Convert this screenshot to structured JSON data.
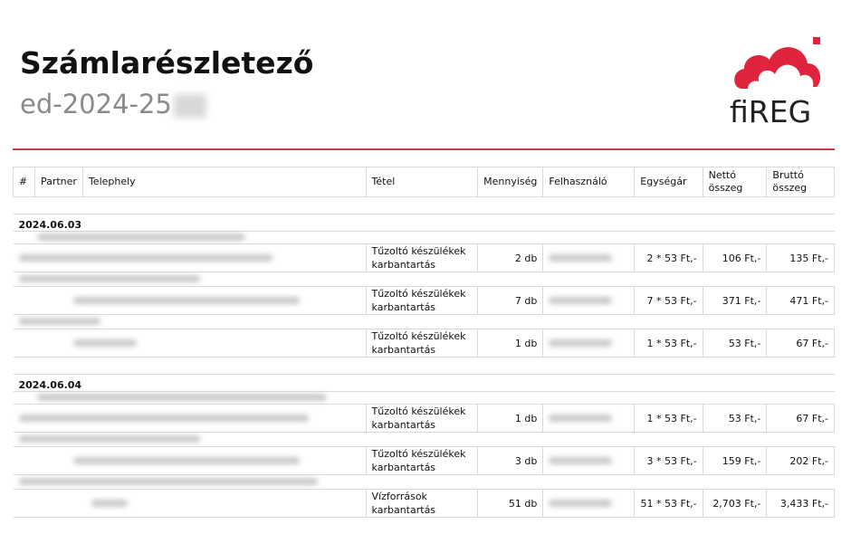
{
  "header": {
    "title": "Számlarészletező",
    "doc_id_prefix": "ed-2024-25",
    "logo_text": "fiREG"
  },
  "colors": {
    "accent": "#c8384d",
    "logo_red": "#e0243e"
  },
  "table": {
    "columns": [
      "#",
      "Partner",
      "Telephely",
      "Tétel",
      "Mennyiség",
      "Felhasználó",
      "Egységár",
      "Nettó összeg",
      "Bruttó összeg"
    ],
    "groups": [
      {
        "date": "2024.06.03",
        "rows": [
          {
            "item": "Tűzoltó készülékek karbantartás",
            "qty": "2 db",
            "unit": "2 * 53 Ft,-",
            "net": "106 Ft,-",
            "gross": "135 Ft,-"
          },
          {
            "item": "Tűzoltó készülékek karbantartás",
            "qty": "7 db",
            "unit": "7 * 53 Ft,-",
            "net": "371 Ft,-",
            "gross": "471 Ft,-"
          },
          {
            "item": "Tűzoltó készülékek karbantartás",
            "qty": "1 db",
            "unit": "1 * 53 Ft,-",
            "net": "53 Ft,-",
            "gross": "67 Ft,-"
          }
        ]
      },
      {
        "date": "2024.06.04",
        "rows": [
          {
            "item": "Tűzoltó készülékek karbantartás",
            "qty": "1 db",
            "unit": "1 * 53 Ft,-",
            "net": "53 Ft,-",
            "gross": "67 Ft,-"
          },
          {
            "item": "Tűzoltó készülékek karbantartás",
            "qty": "3 db",
            "unit": "3 * 53 Ft,-",
            "net": "159 Ft,-",
            "gross": "202 Ft,-"
          },
          {
            "item": "Vízforrások karbantartás",
            "qty": "51 db",
            "unit": "51 * 53 Ft,-",
            "net": "2,703 Ft,-",
            "gross": "3,433 Ft,-"
          }
        ]
      }
    ]
  }
}
